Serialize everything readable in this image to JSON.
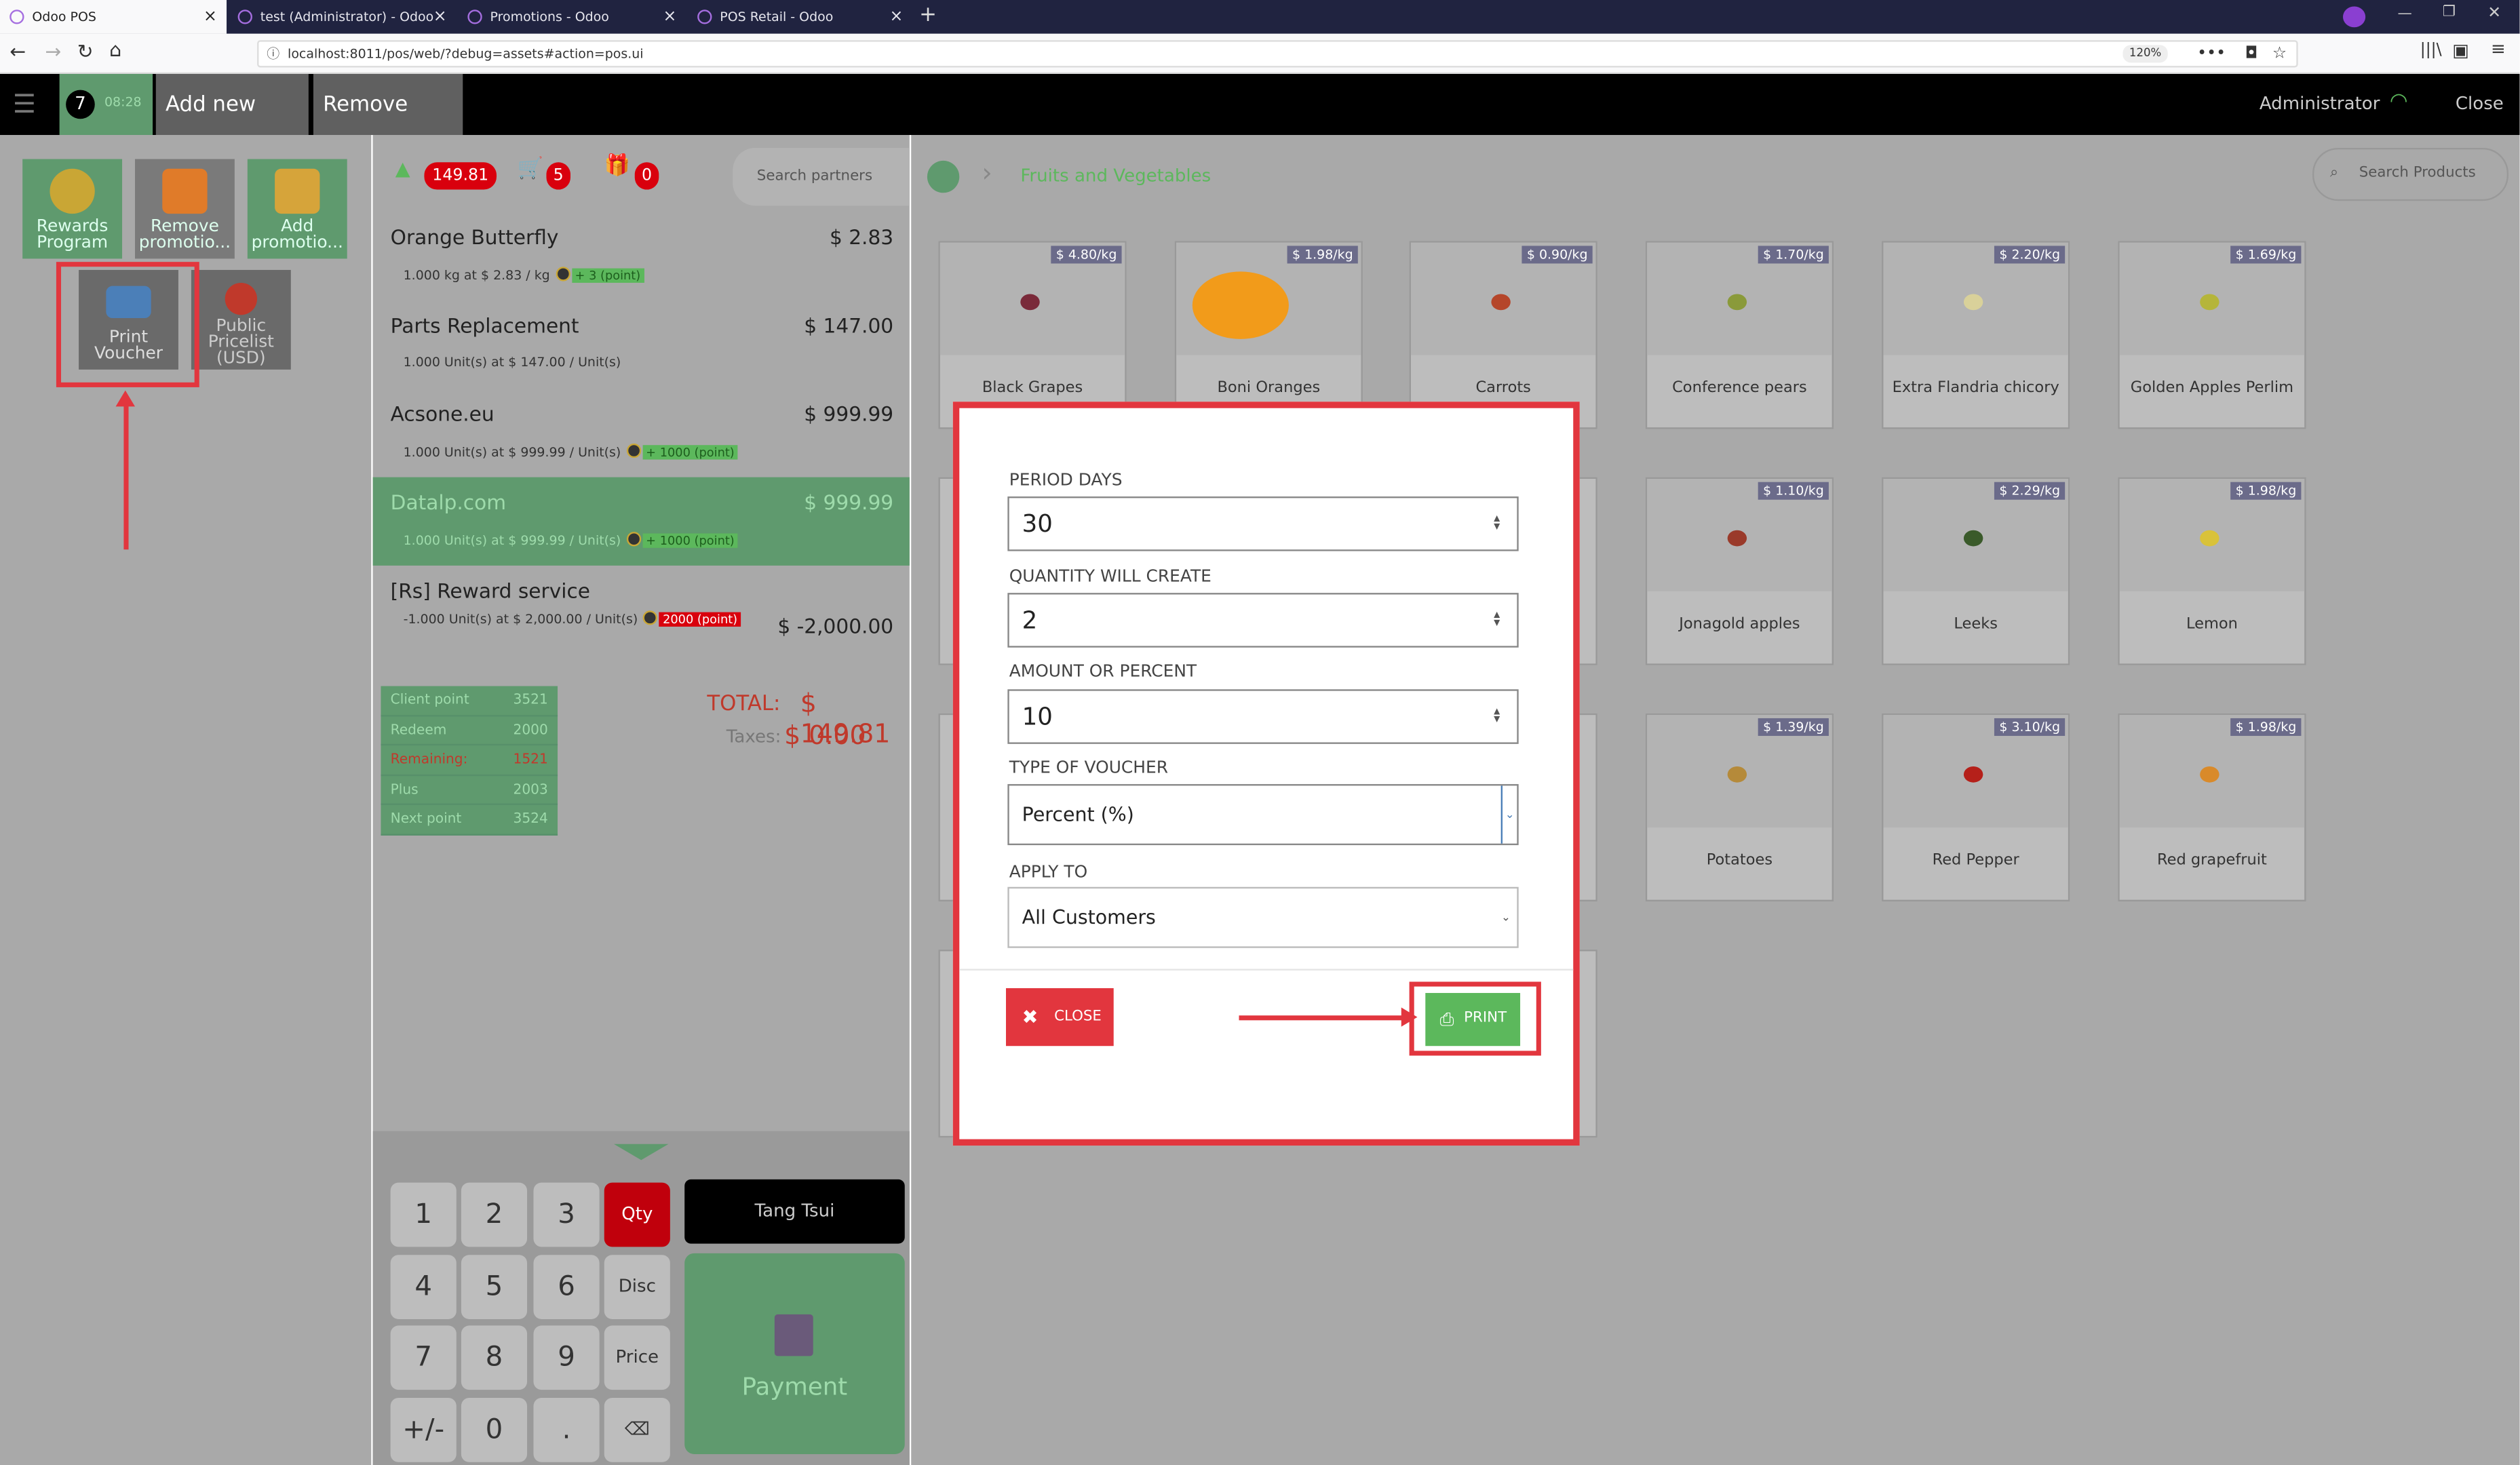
{
  "browser": {
    "tabs": [
      {
        "title": "Odoo POS",
        "active": true
      },
      {
        "title": "test (Administrator) - Odoo",
        "active": false
      },
      {
        "title": "Promotions - Odoo",
        "active": false
      },
      {
        "title": "POS Retail - Odoo",
        "active": false
      }
    ],
    "url": "localhost:8011/pos/web/?debug=assets#action=pos.ui",
    "zoom": "120%",
    "new_tab": "+",
    "close_tab": "×"
  },
  "pos_header": {
    "order_number": "7",
    "order_time": "08:28",
    "add_order": "Add new order",
    "remove_order": "Remove order",
    "user": "Administrator",
    "close": "Close"
  },
  "promotions": [
    {
      "label": "Rewards Program"
    },
    {
      "label": "Remove promotio..."
    },
    {
      "label": "Add promotio..."
    },
    {
      "label": "Print Voucher"
    },
    {
      "label": "Public Pricelist (USD)"
    }
  ],
  "order_header": {
    "points": "149.81",
    "cart_count": "5",
    "gift_count": "0",
    "search_partners_placeholder": "Search partners"
  },
  "order_lines": [
    {
      "name": "Orange Butterfly",
      "price": "$ 2.83",
      "detail": "1.000 kg at $ 2.83 / kg",
      "badge": "+ 3 (point)",
      "badge_type": "green",
      "selected": false
    },
    {
      "name": "Parts Replacement",
      "price": "$ 147.00",
      "detail": "1.000 Unit(s) at $ 147.00 / Unit(s)",
      "badge": "",
      "badge_type": "",
      "selected": false
    },
    {
      "name": "Acsone.eu",
      "price": "$ 999.99",
      "detail": "1.000 Unit(s) at $ 999.99 / Unit(s)",
      "badge": "+ 1000 (point)",
      "badge_type": "green",
      "selected": false
    },
    {
      "name": "Datalp.com",
      "price": "$ 999.99",
      "detail": "1.000 Unit(s) at $ 999.99 / Unit(s)",
      "badge": "+ 1000 (point)",
      "badge_type": "green",
      "selected": true
    },
    {
      "name": "[Rs] Reward service",
      "price": "$ -2,000.00",
      "detail": "-1.000 Unit(s) at $ 2,000.00 / Unit(s)",
      "badge": "2000 (point)",
      "badge_type": "red",
      "selected": false
    }
  ],
  "points_table": [
    {
      "label": "Client point",
      "value": "3521"
    },
    {
      "label": "Redeem",
      "value": "2000"
    },
    {
      "label": "Remaining:",
      "value": "1521"
    },
    {
      "label": "Plus",
      "value": "2003"
    },
    {
      "label": "Next point",
      "value": "3524"
    }
  ],
  "totals": {
    "total_label": "TOTAL:",
    "total_value": "$ 149.81",
    "taxes_label": "Taxes:",
    "taxes_value": "$ 0.00"
  },
  "keypad": {
    "keys": [
      "1",
      "2",
      "3",
      "Qty",
      "4",
      "5",
      "6",
      "Disc",
      "7",
      "8",
      "9",
      "Price",
      "+/-",
      "0",
      ".",
      "⌫"
    ],
    "customer": "Tang Tsui",
    "payment": "Payment"
  },
  "products_header": {
    "category": "Fruits and Vegetables",
    "search_placeholder": "Search Products"
  },
  "products": [
    {
      "name": "Black Grapes",
      "price": "$ 4.80/kg"
    },
    {
      "name": "Boni Oranges",
      "price": "$ 1.98/kg"
    },
    {
      "name": "Carrots",
      "price": "$ 0.90/kg"
    },
    {
      "name": "Conference pears",
      "price": "$ 1.70/kg"
    },
    {
      "name": "Extra Flandria chicory",
      "price": "$ 2.20/kg"
    },
    {
      "name": "Golden Apples Perlim",
      "price": "$ 1.69/kg"
    },
    {
      "name": "Jonagold apples",
      "price": "$ 1.10/kg"
    },
    {
      "name": "Leeks",
      "price": "$ 2.29/kg"
    },
    {
      "name": "Lemon",
      "price": "$ 1.98/kg"
    },
    {
      "name": "Potatoes",
      "price": "$ 1.39/kg"
    },
    {
      "name": "Red Pepper",
      "price": "$ 3.10/kg"
    },
    {
      "name": "Red grapefruit",
      "price": "$ 1.98/kg"
    }
  ],
  "voucher_dialog": {
    "period_days_label": "PERIOD DAYS",
    "period_days_value": "30",
    "quantity_label": "QUANTITY WILL CREATE",
    "quantity_value": "2",
    "amount_label": "AMOUNT OR PERCENT",
    "amount_value": "10",
    "type_label": "TYPE OF VOUCHER",
    "type_value": "Percent (%)",
    "apply_label": "APPLY TO",
    "apply_value": "All Customers",
    "close_button": "CLOSE",
    "print_button": "PRINT"
  },
  "colors": {
    "accent_green": "#5cb85c",
    "alert_red": "#e2363e",
    "browser_dark": "#202340"
  }
}
